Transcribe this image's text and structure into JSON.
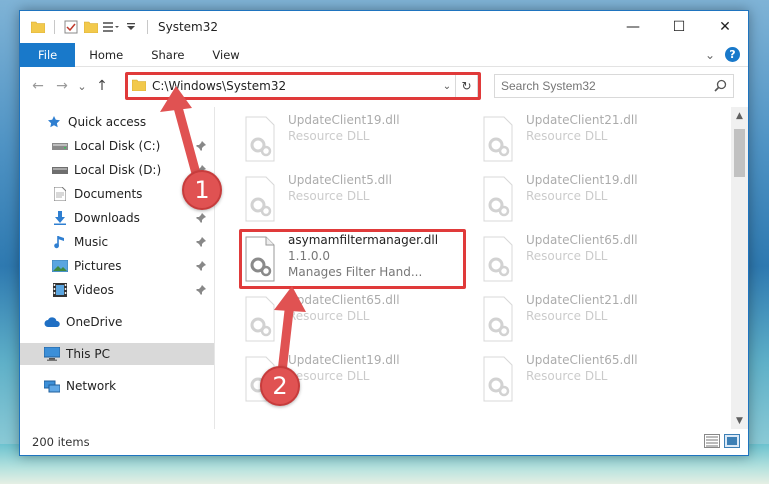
{
  "window": {
    "title": "System32",
    "controls": {
      "minimize": "—",
      "maximize": "☐",
      "close": "✕"
    }
  },
  "ribbon": {
    "tabs": [
      "File",
      "Home",
      "Share",
      "View"
    ],
    "expand_glyph": "⌄",
    "help_glyph": "?"
  },
  "nav": {
    "back": "←",
    "forward": "→",
    "recent": "⌄",
    "up": "↑",
    "address": "C:\\Windows\\System32",
    "address_dropdown": "⌄",
    "refresh": "↻",
    "search_placeholder": "Search System32"
  },
  "sidebar": {
    "items": [
      {
        "label": "Quick access",
        "icon": "star-icon",
        "pinned": false
      },
      {
        "label": "Local Disk (C:)",
        "icon": "drive-icon",
        "pinned": true
      },
      {
        "label": "Local Disk (D:)",
        "icon": "drive-icon",
        "pinned": true
      },
      {
        "label": "Documents",
        "icon": "documents-icon",
        "pinned": true
      },
      {
        "label": "Downloads",
        "icon": "download-icon",
        "pinned": true
      },
      {
        "label": "Music",
        "icon": "music-icon",
        "pinned": true
      },
      {
        "label": "Pictures",
        "icon": "pictures-icon",
        "pinned": true
      },
      {
        "label": "Videos",
        "icon": "videos-icon",
        "pinned": true
      },
      {
        "label": "OneDrive",
        "icon": "cloud-icon",
        "pinned": false
      },
      {
        "label": "This PC",
        "icon": "computer-icon",
        "pinned": false,
        "selected": true
      },
      {
        "label": "Network",
        "icon": "network-icon",
        "pinned": false
      }
    ]
  },
  "files": [
    {
      "name": "UpdateClient19.dll",
      "sub": "Resource DLL"
    },
    {
      "name": "UpdateClient21.dll",
      "sub": "Resource DLL"
    },
    {
      "name": "UpdateClient5.dll",
      "sub": "Resource DLL"
    },
    {
      "name": "UpdateClient19.dll",
      "sub": "Resource DLL"
    },
    {
      "name": "asymamfiltermanager.dll",
      "version": "1.1.0.0",
      "sub": "Manages Filter Hand...",
      "highlighted": true
    },
    {
      "name": "UpdateClient65.dll",
      "sub": "Resource DLL"
    },
    {
      "name": "UpdateClient65.dll",
      "sub": "Resource DLL"
    },
    {
      "name": "UpdateClient21.dll",
      "sub": "Resource DLL"
    },
    {
      "name": "UpdateClient19.dll",
      "sub": "Resource DLL"
    },
    {
      "name": "UpdateClient65.dll",
      "sub": "Resource DLL"
    }
  ],
  "status": {
    "item_count": "200 items"
  },
  "annotations": {
    "step1": "1",
    "step2": "2"
  },
  "colors": {
    "accent": "#1979ca",
    "highlight": "#e03a3a",
    "badge": "#e05252"
  }
}
